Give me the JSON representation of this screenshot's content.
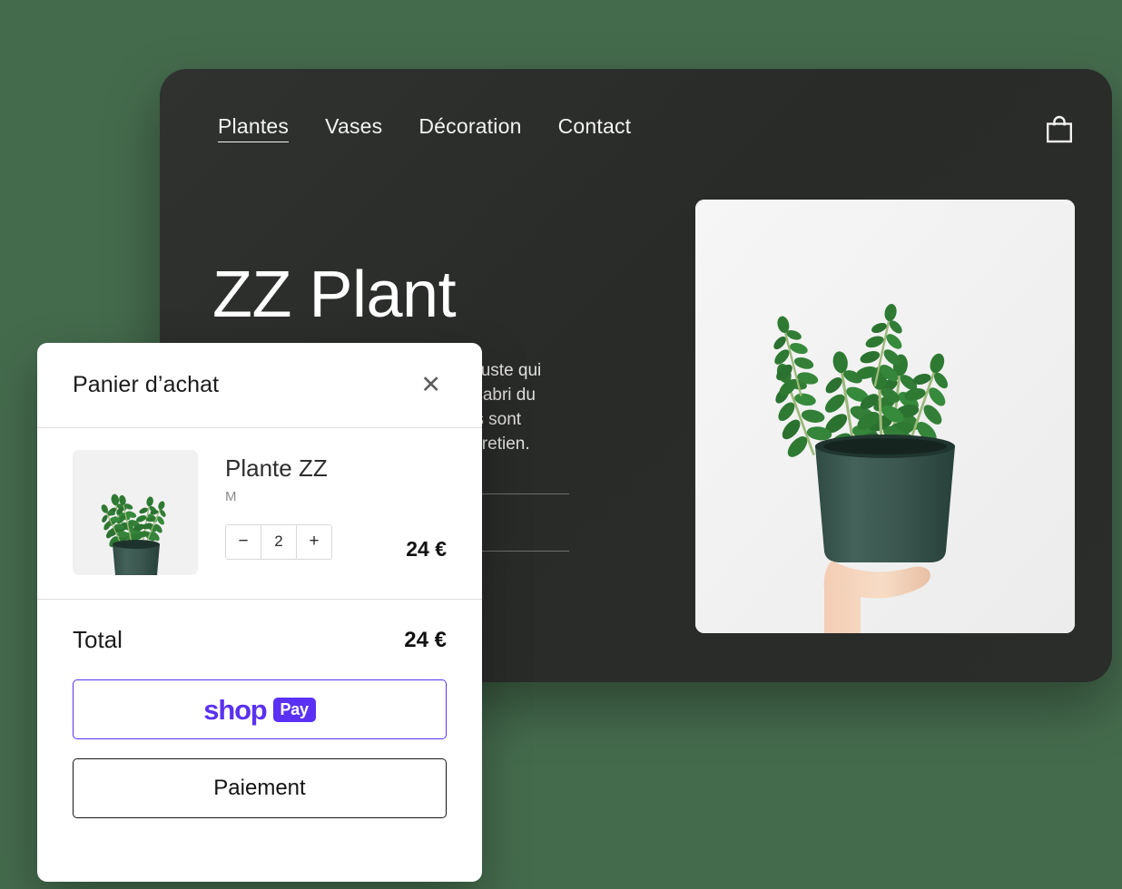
{
  "background_color": "#456b4d",
  "site": {
    "card_color": "#2b2d2b",
    "nav": {
      "items": [
        {
          "label": "Plantes",
          "active": true
        },
        {
          "label": "Vases",
          "active": false
        },
        {
          "label": "Décoration",
          "active": false
        },
        {
          "label": "Contact",
          "active": false
        }
      ],
      "cart_icon": "shopping-bag-icon"
    },
    "hero": {
      "title": "ZZ Plant",
      "description": "Le ZZ est une plante d’intérieur robuste qui placé dans un endroit lumineux, à l’abri du soleil direct. Ses feuilles vernissées sont résistantes et demandent peu d’entretien."
    }
  },
  "cart": {
    "title": "Panier d’achat",
    "close_icon": "close-icon",
    "item": {
      "name": "Plante ZZ",
      "variant": "M",
      "quantity": "2",
      "decrease_label": "−",
      "increase_label": "+",
      "price": "24 €",
      "thumbnail_alt": "zz-plant-thumbnail"
    },
    "total_label": "Total",
    "total_value": "24 €",
    "shop_pay": {
      "word": "shop",
      "badge": "Pay",
      "brand_color": "#5a31f4"
    },
    "checkout_label": "Paiement"
  }
}
